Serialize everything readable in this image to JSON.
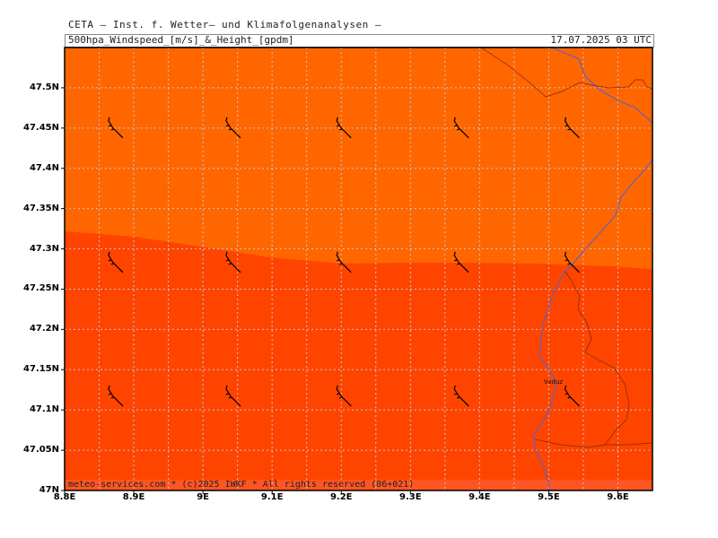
{
  "header": {
    "institute": "CETA — Inst. f. Wetter— und Klimafolgenanalysen —",
    "title": "500hpa_Windspeed_[m/s]_&_Height_[gpdm]",
    "valid_time": "17.07.2025 03 UTC"
  },
  "axes": {
    "y_ticks": [
      "47.5N",
      "47.45N",
      "47.4N",
      "47.35N",
      "47.3N",
      "47.25N",
      "47.2N",
      "47.15N",
      "47.1N",
      "47.05N",
      "47N"
    ],
    "x_ticks": [
      "8.8E",
      "8.9E",
      "9E",
      "9.1E",
      "9.2E",
      "9.3E",
      "9.4E",
      "9.5E",
      "9.6E"
    ]
  },
  "map": {
    "place_label": "Vaduz",
    "lon_range": [
      8.8,
      9.65
    ],
    "lat_range": [
      47.0,
      47.55
    ],
    "colors": {
      "north_fill": "#ff6600",
      "south_fill": "#ff4400",
      "bottom_band": "#ff5522",
      "grid": "#c8c8c8",
      "border": "#6060c0",
      "coast": "#7a2a10",
      "barb": "#000000"
    },
    "wind_barbs": [
      {
        "lon": 8.87,
        "lat": 47.45
      },
      {
        "lon": 9.04,
        "lat": 47.45
      },
      {
        "lon": 9.2,
        "lat": 47.45
      },
      {
        "lon": 9.37,
        "lat": 47.45
      },
      {
        "lon": 9.53,
        "lat": 47.45
      },
      {
        "lon": 8.87,
        "lat": 47.283
      },
      {
        "lon": 9.04,
        "lat": 47.283
      },
      {
        "lon": 9.2,
        "lat": 47.283
      },
      {
        "lon": 9.37,
        "lat": 47.283
      },
      {
        "lon": 9.53,
        "lat": 47.283
      },
      {
        "lon": 8.87,
        "lat": 47.117
      },
      {
        "lon": 9.04,
        "lat": 47.117
      },
      {
        "lon": 9.2,
        "lat": 47.117
      },
      {
        "lon": 9.37,
        "lat": 47.117
      },
      {
        "lon": 9.53,
        "lat": 47.117
      }
    ]
  },
  "footer": {
    "copyright": "meteo-services.com * (c)2025 IWKF * All rights reserved (06+021)"
  }
}
